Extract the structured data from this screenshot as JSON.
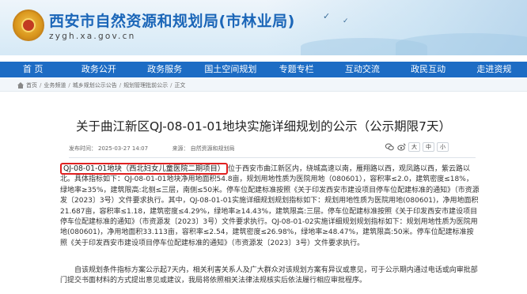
{
  "header": {
    "title": "西安市自然资源和规划局(市林业局)",
    "domain": "zygh.xa.gov.cn"
  },
  "nav": {
    "items": [
      "首 页",
      "政务公开",
      "政务服务",
      "国土空间规划",
      "专题专栏",
      "互动交流",
      "政民互动",
      "走进资规"
    ]
  },
  "breadcrumb": {
    "items": [
      "首页",
      "业务频道",
      "城乡规划公示公告",
      "规划管理批前公示",
      "正文"
    ]
  },
  "article": {
    "title": "关于曲江新区QJ-08-01-01地块实施详细规划的公示（公示期限7天）",
    "publish_label": "发布时间：",
    "publish_time": "2025-03-27 14:07",
    "source_label": "来源：",
    "source": "自然资源和规划局",
    "font_large": "大",
    "font_medium": "中",
    "font_small": "小",
    "highlight": "QJ-08-01-01地块（西北妇女儿童医院二期项目）",
    "paragraph1_rest": "位于西安市曲江新区内，绕城高速以南，雁翔路以西，观凤路以西，紫云路以北。具体指标如下：QJ-08-01-01地块净用地面积54.8亩，规划用地性质为医院用地（080601），容积率≤2.0，建筑密度≤18%，绿地率≥35%，建筑限高:北侧≤三层，南侧≤50米。停车位配建标准按照《关于印发西安市建设项目停车位配建标准的通知》（市资源发〔2023〕3号）文件要求执行。其中，QJ-08-01-01实施详细规划规划指标如下：规划用地性质为医院用地(080601)，净用地面积21.687亩，容积率≤1.18，建筑密度≤4.29%，绿地率≥14.43%，建筑限高:三层。停车位配建标准按照《关于印发西安市建设项目停车位配建标准的通知》（市资源发〔2023〕3号）文件要求执行。QJ-08-01-02实施详细规划规划指标如下：规划用地性质为医院用地(080601)，净用地面积33.113亩，容积率≤2.54，建筑密度≤26.98%，绿地率≥48.47%，建筑限高:50米。停车位配建标准按照《关于印发西安市建设项目停车位配建标准的通知》（市资源发〔2023〕3号）文件要求执行。",
    "paragraph2": "自该规划条件指标方案公示起7天内，相关利害关系人及广大群众对该规划方案有异议或意见，可于公示期内通过电话或向审批部门提交书面材料的方式提出意见或建议，我局将依照相关法律法规核实后依法履行相应审批程序。"
  },
  "colors": {
    "nav_bg": "#1d6cc4",
    "title_blue": "#1b66b8",
    "highlight_border": "#e02020"
  }
}
